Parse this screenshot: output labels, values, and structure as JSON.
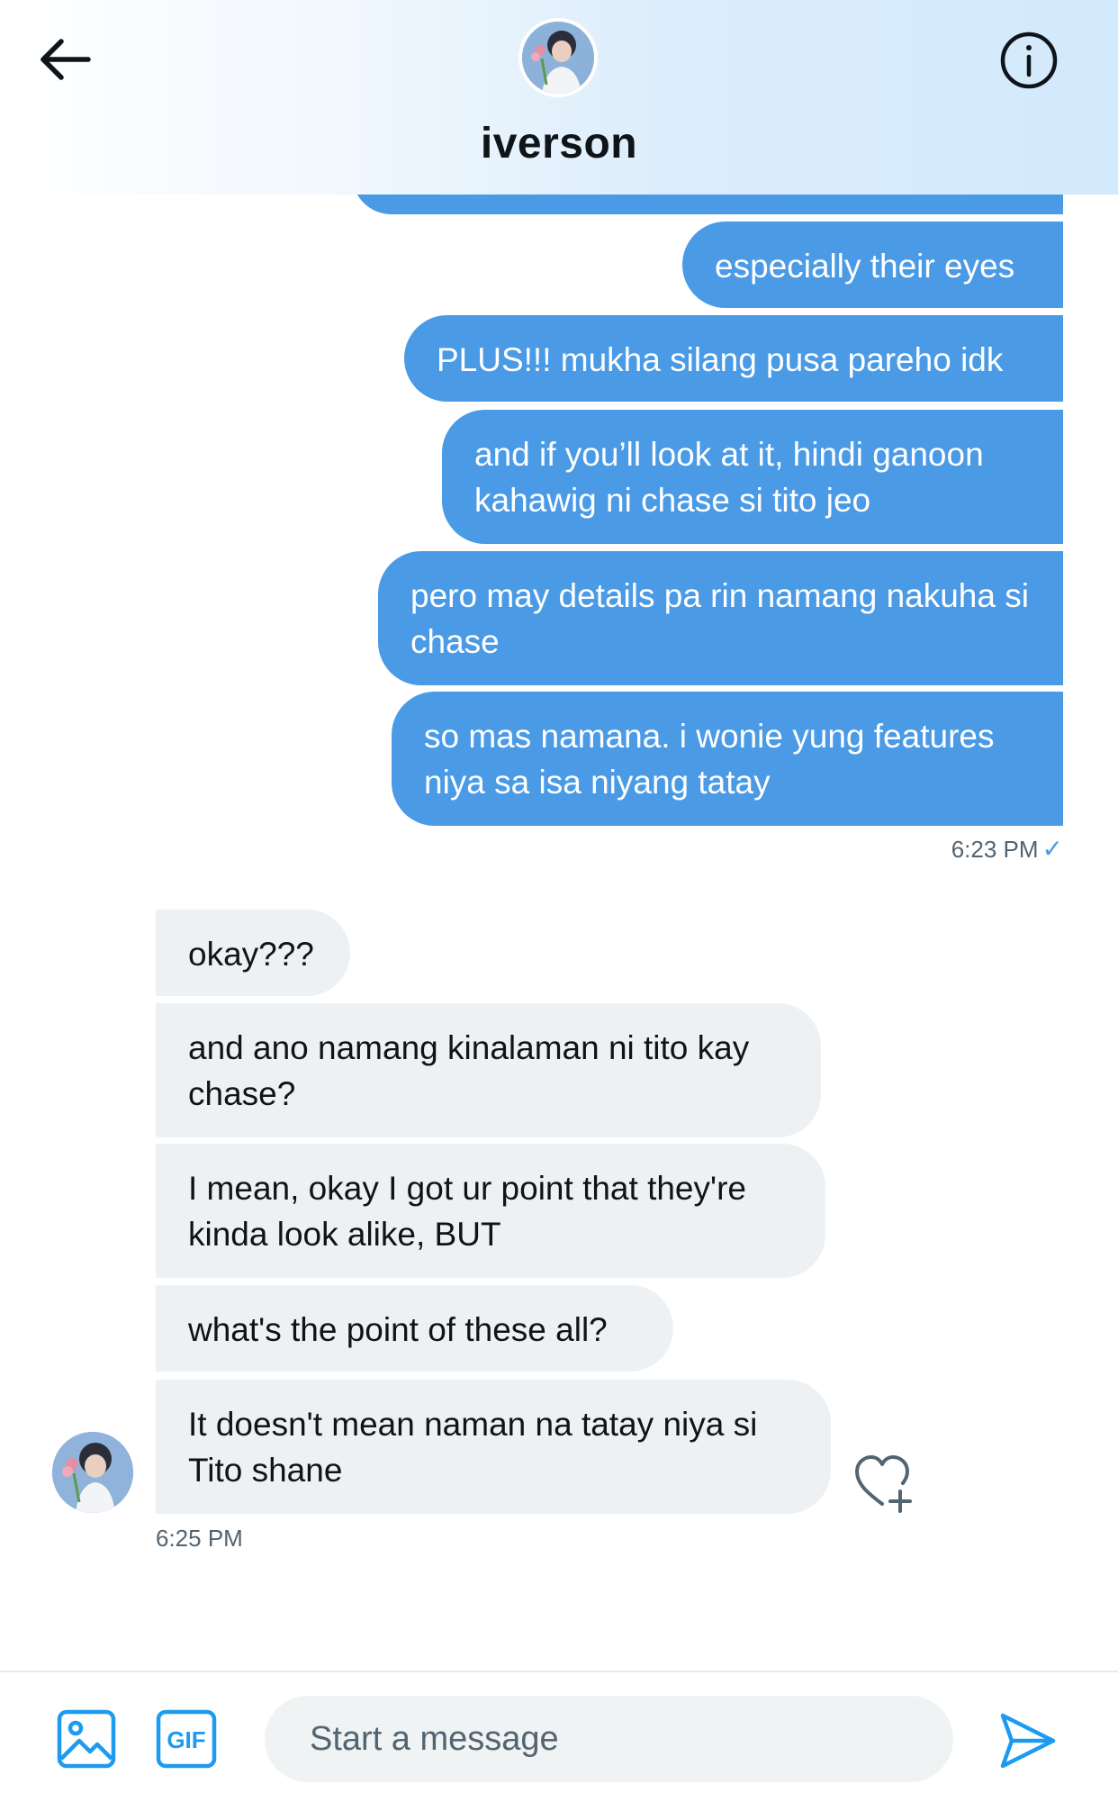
{
  "header": {
    "contact_name": "iverson",
    "icons": {
      "back": "arrow-left-icon",
      "info": "info-circle-icon"
    }
  },
  "thread": {
    "outgoing": [
      "especially their eyes",
      "PLUS!!! mukha silang pusa pareho idk",
      "and if you’ll look at it, hindi ganoon kahawig ni chase si tito jeo",
      "pero may details pa rin namang nakuha si chase",
      "so mas namana. i wonie yung features niya sa isa niyang tatay"
    ],
    "outgoing_time": "6:23 PM",
    "incoming": [
      "okay???",
      "and ano namang kinalaman ni tito kay chase?",
      "I mean, okay I got ur point that they're kinda look alike, BUT",
      "what's the point of these all?",
      "It doesn't mean naman na tatay niya si Tito shane"
    ],
    "incoming_time": "6:25 PM"
  },
  "composer": {
    "placeholder": "Start a message",
    "gif_label": "GIF"
  },
  "colors": {
    "outgoing_bubble": "#4a9ae6",
    "incoming_bubble": "#eef1f3",
    "accent": "#1d9bf0"
  }
}
